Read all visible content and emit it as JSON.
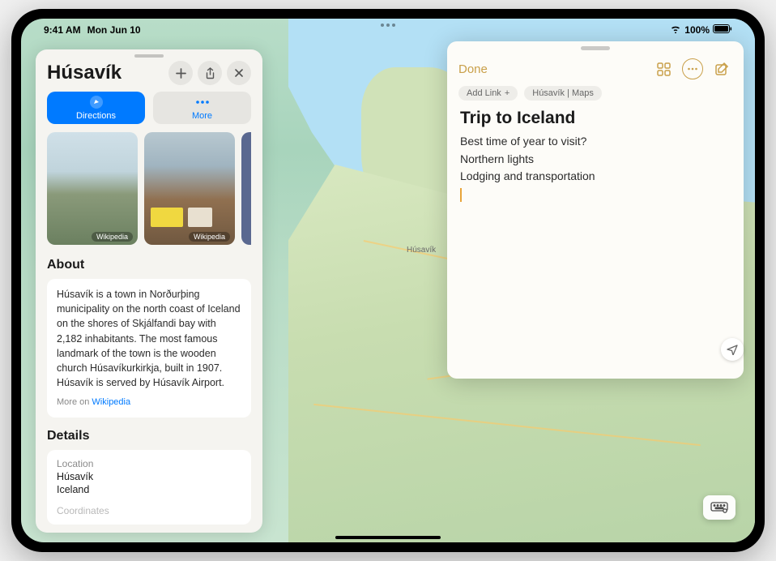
{
  "status": {
    "time": "9:41 AM",
    "date": "Mon Jun 10",
    "battery": "100%"
  },
  "place": {
    "title": "Húsavík",
    "directions_label": "Directions",
    "more_label": "More",
    "photo_credit": "Wikipedia",
    "about_header": "About",
    "about_text": "Húsavík is a town in Norðurþing municipality on the north coast of Iceland on the shores of Skjálfandi bay with 2,182 inhabitants. The most famous landmark of the town is the wooden church Húsavíkurkirkja, built in 1907. Húsavík is served by Húsavík Airport.",
    "more_on": "More on ",
    "wiki": "Wikipedia",
    "details_header": "Details",
    "location_label": "Location",
    "location_line1": "Húsavík",
    "location_line2": "Iceland",
    "coords_label": "Coordinates"
  },
  "map": {
    "place_label": "Húsavík"
  },
  "notes": {
    "done": "Done",
    "add_link": "Add Link",
    "breadcrumb": "Húsavík | Maps",
    "title": "Trip to Iceland",
    "lines": [
      "Best time of year to visit?",
      "Northern lights",
      "Lodging and transportation"
    ]
  }
}
